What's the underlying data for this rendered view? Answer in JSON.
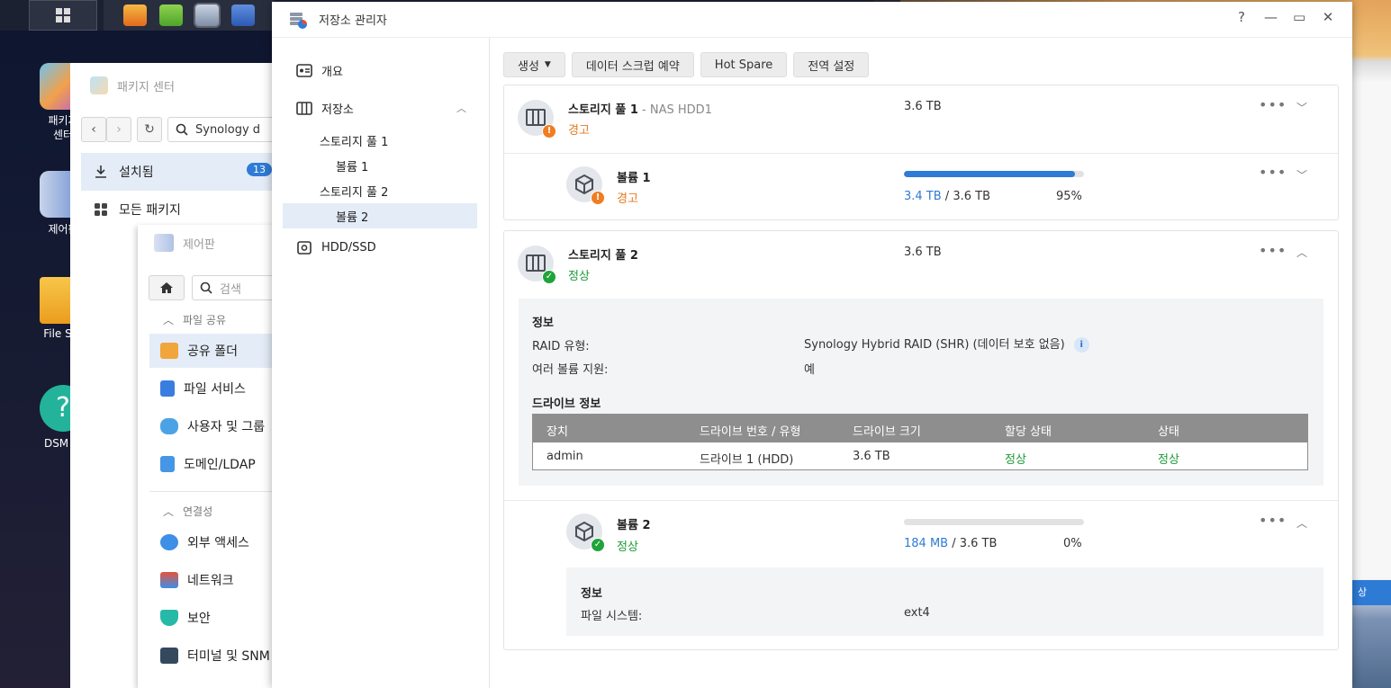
{
  "desktop": {
    "icons": [
      {
        "label": "패키지\n센터"
      },
      {
        "label": "제어판"
      },
      {
        "label": "File Sta"
      },
      {
        "label": "DSM 도"
      }
    ]
  },
  "package_center": {
    "title": "패키지 센터",
    "search_value": "Synology d",
    "nav": [
      {
        "label": "설치됨",
        "count": "13"
      },
      {
        "label": "모든 패키지"
      }
    ]
  },
  "control_panel": {
    "title": "제어판",
    "search_placeholder": "검색",
    "sections": [
      {
        "label": "파일 공유"
      },
      {
        "label": "연결성"
      }
    ],
    "items": [
      {
        "label": "공유 폴더"
      },
      {
        "label": "파일 서비스"
      },
      {
        "label": "사용자 및 그룹"
      },
      {
        "label": "도메인/LDAP"
      },
      {
        "label": "외부 액세스"
      },
      {
        "label": "네트워크"
      },
      {
        "label": "보안"
      },
      {
        "label": "터미널 및 SNM"
      }
    ]
  },
  "storage_manager": {
    "title": "저장소 관리자",
    "window_buttons": {
      "help": "?",
      "minimize": "—",
      "maximize": "▭",
      "close": "✕"
    },
    "sidebar": {
      "overview": "개요",
      "storage": "저장소",
      "pool1": "스토리지 풀 1",
      "volume1": "볼륨 1",
      "pool2": "스토리지 풀 2",
      "volume2": "볼륨 2",
      "hdd": "HDD/SSD"
    },
    "toolbar": {
      "create": "생성",
      "scrub": "데이터 스크럽 예약",
      "hotspare": "Hot Spare",
      "global": "전역 설정"
    },
    "pool1": {
      "name": "스토리지 풀 1",
      "subtitle": " - NAS HDD1",
      "status": "경고",
      "capacity": "3.6 TB"
    },
    "volume1": {
      "name": "볼륨 1",
      "status": "경고",
      "used": "3.4 TB",
      "total": " / 3.6 TB",
      "percent_label": "95%",
      "usage_fraction": 0.95
    },
    "pool2": {
      "name": "스토리지 풀 2",
      "status": "정상",
      "capacity": "3.6 TB",
      "info_title": "정보",
      "raid_key": "RAID 유형:",
      "raid_val": "Synology Hybrid RAID (SHR) (데이터 보호 없음)",
      "multi_key": "여러 볼륨 지원:",
      "multi_val": "예",
      "drive_title": "드라이브 정보",
      "table": {
        "headers": [
          "장치",
          "드라이브 번호 / 유형",
          "드라이브 크기",
          "할당 상태",
          "상태"
        ],
        "row": [
          "admin",
          "드라이브 1 (HDD)",
          "3.6 TB",
          "정상",
          "정상"
        ]
      }
    },
    "volume2": {
      "name": "볼륨 2",
      "status": "정상",
      "used": "184 MB",
      "total": " / 3.6 TB",
      "percent_label": "0%",
      "usage_fraction": 0.0,
      "info_title": "정보",
      "fs_key": "파일 시스템:",
      "fs_val": "ext4"
    }
  }
}
